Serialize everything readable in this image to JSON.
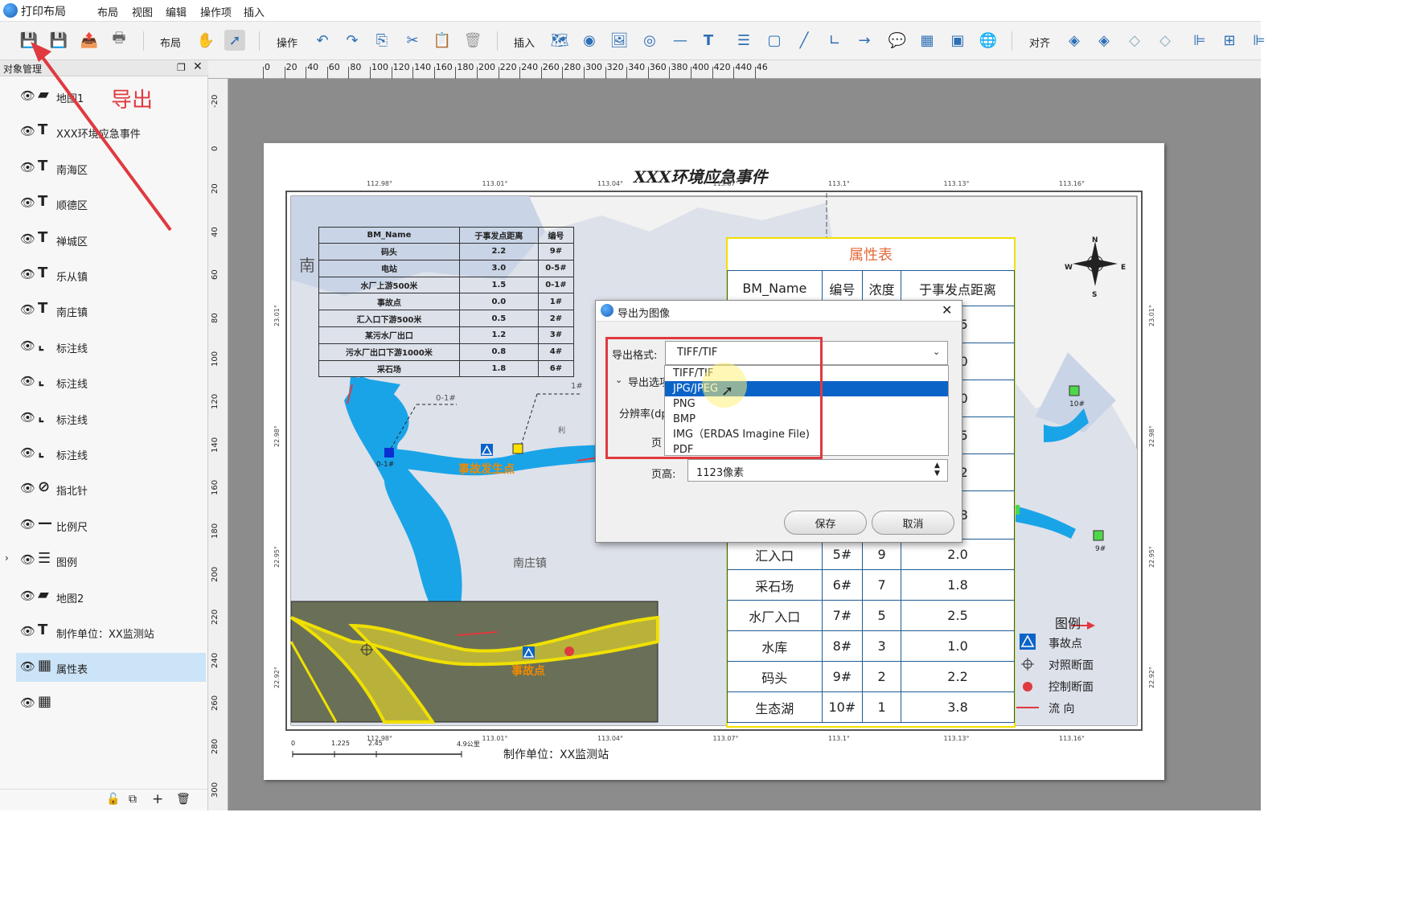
{
  "app": {
    "title": "打印布局"
  },
  "menus": [
    "布局",
    "视图",
    "编辑",
    "操作项",
    "插入"
  ],
  "toolbar": {
    "layout": "布局",
    "ops": "操作",
    "insert": "插入",
    "align": "对齐"
  },
  "panel": {
    "title": "对象管理",
    "items": [
      {
        "icon": "map",
        "label": "地图1"
      },
      {
        "icon": "T",
        "label": "XXX环境应急事件"
      },
      {
        "icon": "T",
        "label": "南海区"
      },
      {
        "icon": "T",
        "label": "顺德区"
      },
      {
        "icon": "T",
        "label": "禅城区"
      },
      {
        "icon": "T",
        "label": "乐从镇"
      },
      {
        "icon": "T",
        "label": "南庄镇"
      },
      {
        "icon": "line",
        "label": "标注线"
      },
      {
        "icon": "line",
        "label": "标注线"
      },
      {
        "icon": "line",
        "label": "标注线"
      },
      {
        "icon": "line",
        "label": "标注线"
      },
      {
        "icon": "compass",
        "label": "指北针"
      },
      {
        "icon": "scale",
        "label": "比例尺"
      },
      {
        "icon": "legend",
        "label": "图例"
      },
      {
        "icon": "map",
        "label": "地图2"
      },
      {
        "icon": "T",
        "label": "制作单位：XX监测站"
      },
      {
        "icon": "table",
        "label": "属性表"
      },
      {
        "icon": "table",
        "label": ""
      }
    ]
  },
  "annotation": {
    "export": "导出"
  },
  "ruler": {
    "top": [
      "0",
      "20",
      "40",
      "60",
      "80",
      "100",
      "120",
      "140",
      "160",
      "180",
      "200",
      "220",
      "240",
      "260",
      "280",
      "300",
      "320",
      "340",
      "360",
      "380",
      "400",
      "420",
      "440",
      "46"
    ],
    "left": [
      "-20",
      "0",
      "20",
      "40",
      "60",
      "80",
      "100",
      "120",
      "140",
      "160",
      "180",
      "200",
      "220",
      "240",
      "260",
      "280",
      "300"
    ]
  },
  "map": {
    "title": "XXX环境应急事件",
    "top_coords": [
      "112.98°",
      "113.01°",
      "113.04°",
      "113.07°",
      "113.1°",
      "113.13°",
      "113.16°"
    ],
    "bottom_coords": [
      "112.98°",
      "113.01°",
      "113.04°",
      "113.07°",
      "113.1°",
      "113.13°",
      "113.16°"
    ],
    "left_coords": [
      "23.01°",
      "22.98°",
      "22.95°",
      "22.92°"
    ],
    "right_coords": [
      "23.01°",
      "22.98°",
      "22.95°",
      "22.92°"
    ],
    "labels": {
      "nan": "南",
      "nanzhuang": "南庄镇",
      "accident": "事故发生点",
      "accident2": "事故点",
      "l01": "0-1#",
      "l1": "1#",
      "l01b": "0-1#",
      "l10": "10#",
      "l9": "9#",
      "li": "利"
    },
    "north": {
      "n": "N",
      "s": "S",
      "e": "E",
      "w": "W"
    },
    "scale": {
      "labels": [
        "0",
        "1.225",
        "2.45",
        "4.9公里"
      ]
    },
    "footer": "制作单位：XX监测站",
    "small_table": {
      "headers": [
        "BM_Name",
        "于事发点距离",
        "编号"
      ],
      "rows": [
        [
          "码头",
          "2.2",
          "9#"
        ],
        [
          "电站",
          "3.0",
          "0-5#"
        ],
        [
          "水厂上游500米",
          "1.5",
          "0-1#"
        ],
        [
          "事故点",
          "0.0",
          "1#"
        ],
        [
          "汇入口下游500米",
          "0.5",
          "2#"
        ],
        [
          "某污水厂出口",
          "1.2",
          "3#"
        ],
        [
          "污水厂出口下游1000米",
          "0.8",
          "4#"
        ],
        [
          "采石场",
          "1.8",
          "6#"
        ]
      ]
    },
    "attr_table": {
      "title": "属性表",
      "headers": [
        "BM_Name",
        "编号",
        "浓度",
        "于事发点距离"
      ],
      "top_values": [
        "1.5",
        "3.0",
        "0.0",
        "0.5",
        "1.2",
        "0.8"
      ],
      "rows": [
        [
          "汇入口",
          "5#",
          "9",
          "2.0"
        ],
        [
          "采石场",
          "6#",
          "7",
          "1.8"
        ],
        [
          "水厂入口",
          "7#",
          "5",
          "2.5"
        ],
        [
          "水库",
          "8#",
          "3",
          "1.0"
        ],
        [
          "码头",
          "9#",
          "2",
          "2.2"
        ],
        [
          "生态湖",
          "10#",
          "1",
          "3.8"
        ]
      ]
    },
    "legend": {
      "title": "图例",
      "items": [
        "事故点",
        "对照断面",
        "控制断面",
        "流  向"
      ]
    }
  },
  "dialog": {
    "title": "导出为图像",
    "format_label": "导出格式:",
    "format_value": "TIFF/TIF",
    "options": [
      "TIFF/TIF",
      "JPG/JPEG",
      "PNG",
      "BMP",
      "IMG（ERDAS Imagine File)",
      "PDF"
    ],
    "selected_index": 1,
    "section": "导出选项",
    "dpi_label": "分辨率(dp",
    "page_label": "页",
    "height_label": "页高:",
    "height_value": "1123像素",
    "save": "保存",
    "cancel": "取消"
  },
  "colors": {
    "accent": "#e0393f",
    "water": "#1aa4e8",
    "select": "#0a64c8",
    "frame": "#f0e000"
  }
}
